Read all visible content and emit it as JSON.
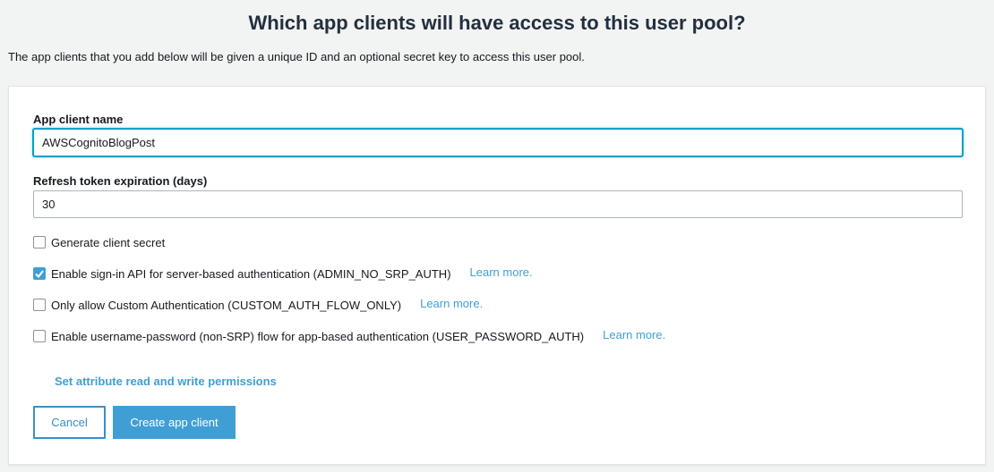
{
  "header": {
    "title": "Which app clients will have access to this user pool?",
    "subtitle": "The app clients that you add below will be given a unique ID and an optional secret key to access this user pool."
  },
  "form": {
    "app_client_name": {
      "label": "App client name",
      "value": "AWSCognitoBlogPost"
    },
    "refresh_token": {
      "label": "Refresh token expiration (days)",
      "value": "30"
    },
    "options": [
      {
        "label": "Generate client secret",
        "checked": false,
        "learn_more": ""
      },
      {
        "label": "Enable sign-in API for server-based authentication (ADMIN_NO_SRP_AUTH)",
        "checked": true,
        "learn_more": "Learn more."
      },
      {
        "label": "Only allow Custom Authentication (CUSTOM_AUTH_FLOW_ONLY)",
        "checked": false,
        "learn_more": "Learn more."
      },
      {
        "label": "Enable username-password (non-SRP) flow for app-based authentication (USER_PASSWORD_AUTH)",
        "checked": false,
        "learn_more": "Learn more."
      }
    ],
    "permissions_link": "Set attribute read and write permissions",
    "cancel_label": "Cancel",
    "create_label": "Create app client"
  },
  "colors": {
    "accent": "#3f9fd5",
    "focus": "#00a1c9",
    "checkbox_checked": "#3f9fd5"
  }
}
